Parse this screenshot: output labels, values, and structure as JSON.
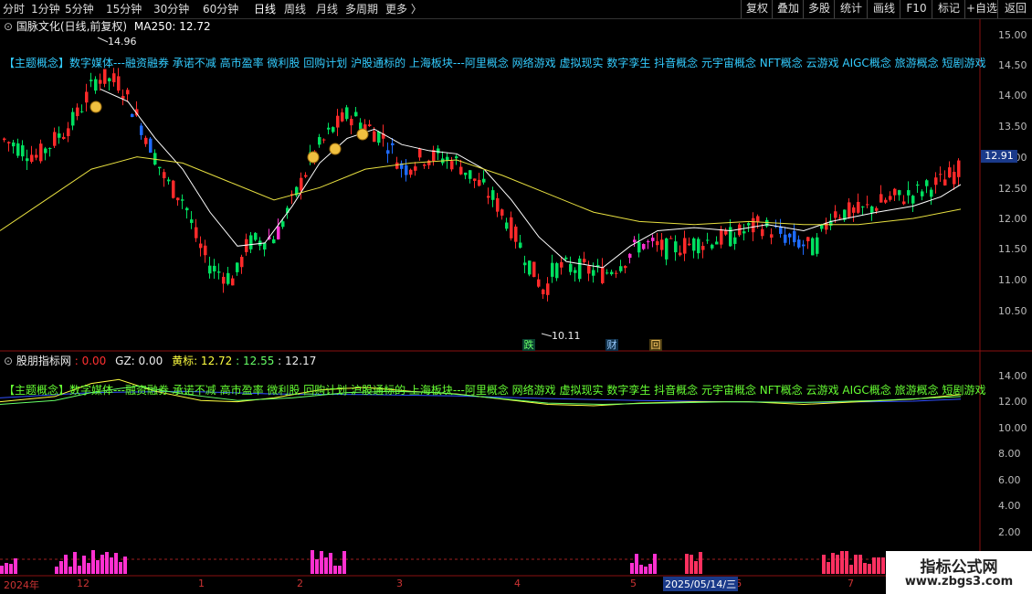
{
  "toolbar": {
    "left_items": [
      "分时",
      "1分钟",
      "5分钟",
      "15分钟",
      "30分钟",
      "60分钟",
      "日线",
      "周线",
      "月线",
      "多周期",
      "更多 〉"
    ],
    "right_items": [
      "复权",
      "叠加",
      "多股",
      "统计",
      "画线",
      "F10",
      "标记",
      "+自选",
      "返回"
    ]
  },
  "main_header": {
    "title": "国脉文化(日线,前复权)",
    "ma_label": "MA250: 12.72"
  },
  "price_axis": [
    "15.00",
    "14.50",
    "14.00",
    "13.50",
    "13.00",
    "12.50",
    "12.00",
    "11.50",
    "11.00",
    "10.50"
  ],
  "current_price": "12.91",
  "annotations": {
    "high": "14.96",
    "low": "10.11",
    "marker_die": "跌",
    "marker_cai": "财",
    "marker_hui": "回"
  },
  "concept_text": "【主题概念】数字媒体---融资融券 承诺不减 高市盈率 微利股 回购计划 沪股通标的 上海板块---阿里概念 网络游戏 虚拟现实 数字孪生 抖音概念 元宇宙概念 NFT概念 云游戏 AIGC概念 旅游概念 短剧游戏",
  "indicator_header": {
    "name": "股朋指标网",
    "val1": ": 0.00",
    "gz": "GZ: 0.00",
    "huang": "黄标: 12.72",
    "val2": ": 12.55",
    "val3": ": 12.17"
  },
  "indicator_axis": [
    "14.00",
    "12.00",
    "10.00",
    "8.00",
    "6.00",
    "4.00",
    "2.00"
  ],
  "date_axis": {
    "year": "2024年",
    "ticks": [
      "12",
      "1",
      "2",
      "3",
      "4",
      "5",
      "6",
      "7"
    ],
    "highlight": "2025/05/14/三"
  },
  "watermark": {
    "line1": "指标公式网",
    "line2": "www.zbgs3.com"
  },
  "colors": {
    "up": "#ff2a2a",
    "down": "#00e060",
    "blue": "#1e6bff",
    "magenta": "#ff30d0",
    "ma_white": "#ffffff",
    "ma_yellow": "#e8e040",
    "concept_cyan": "#33ccff"
  }
}
